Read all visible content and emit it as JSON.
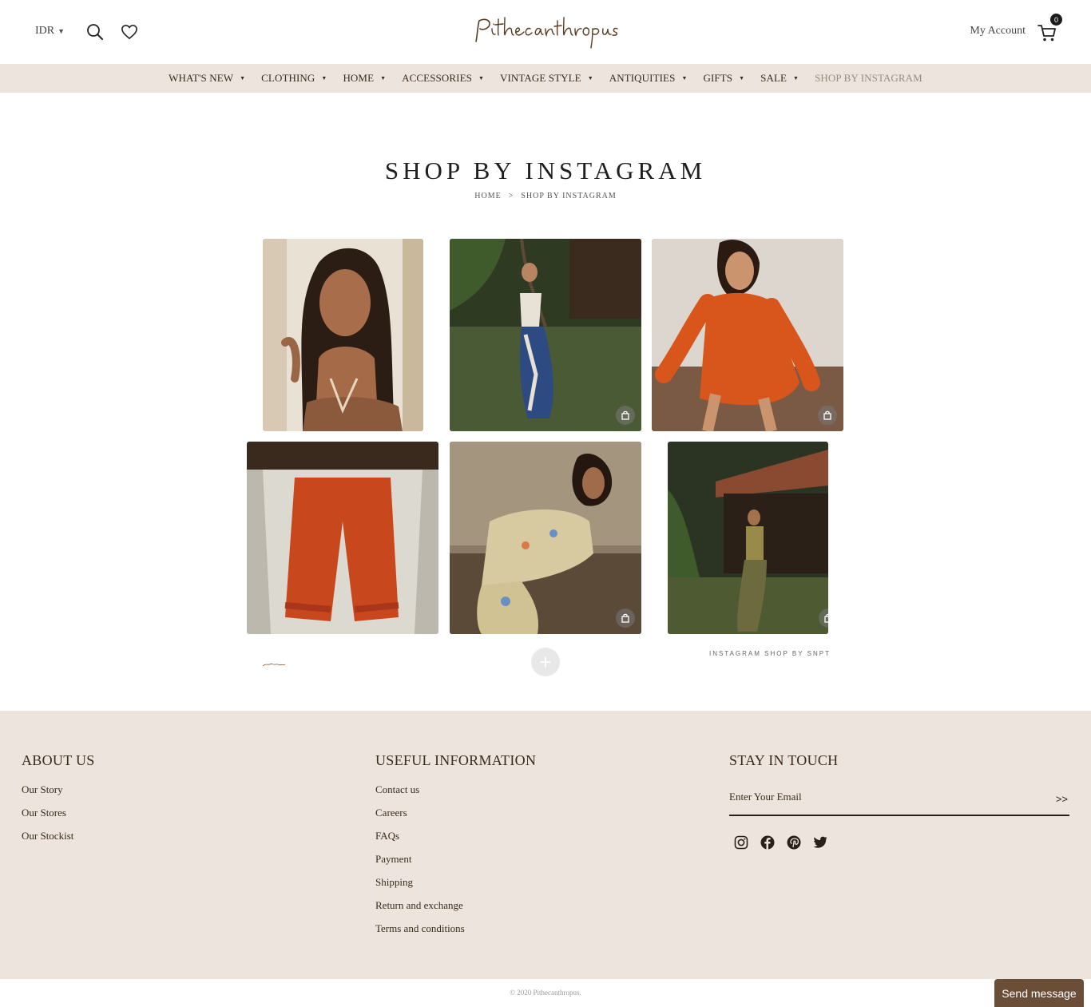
{
  "header": {
    "currency": "IDR",
    "account_label": "My Account",
    "cart_count": "0",
    "icons": [
      "search-icon",
      "heart-icon",
      "cart-icon",
      "caret-down-icon"
    ]
  },
  "nav": {
    "items": [
      {
        "label": "WHAT'S NEW"
      },
      {
        "label": "CLOTHING"
      },
      {
        "label": "HOME"
      },
      {
        "label": "ACCESSORIES"
      },
      {
        "label": "VINTAGE STYLE"
      },
      {
        "label": "ANTIQUITIES"
      },
      {
        "label": "GIFTS"
      },
      {
        "label": "SALE"
      },
      {
        "label": "SHOP BY INSTAGRAM"
      }
    ]
  },
  "page": {
    "title": "SHOP BY INSTAGRAM",
    "breadcrumb": {
      "home": "HOME",
      "separator": ">",
      "current": "SHOP BY INSTAGRAM"
    }
  },
  "gallery": {
    "credit": "INSTAGRAM SHOP BY SNPT",
    "load_more_symbol": "+",
    "colors": {
      "dress": "#d8561c",
      "pants": "#c9471d",
      "lawn": "#4a5a35"
    }
  },
  "footer": {
    "about": {
      "heading": "ABOUT US",
      "links": [
        "Our Story",
        "Our Stores",
        "Our Stockist"
      ]
    },
    "info": {
      "heading": "USEFUL INFORMATION",
      "links": [
        "Contact us",
        "Careers",
        "FAQs",
        "Payment",
        "Shipping",
        "Return and exchange",
        "Terms and conditions"
      ]
    },
    "touch": {
      "heading": "STAY IN TOUCH",
      "email_placeholder": "Enter Your Email",
      "submit": ">>",
      "social_icons": [
        "instagram-icon",
        "facebook-icon",
        "pinterest-icon",
        "twitter-icon"
      ]
    },
    "copyright": "© 2020 Pithecanthropus.",
    "send_message": "Send message",
    "background": "#ede5dd"
  }
}
